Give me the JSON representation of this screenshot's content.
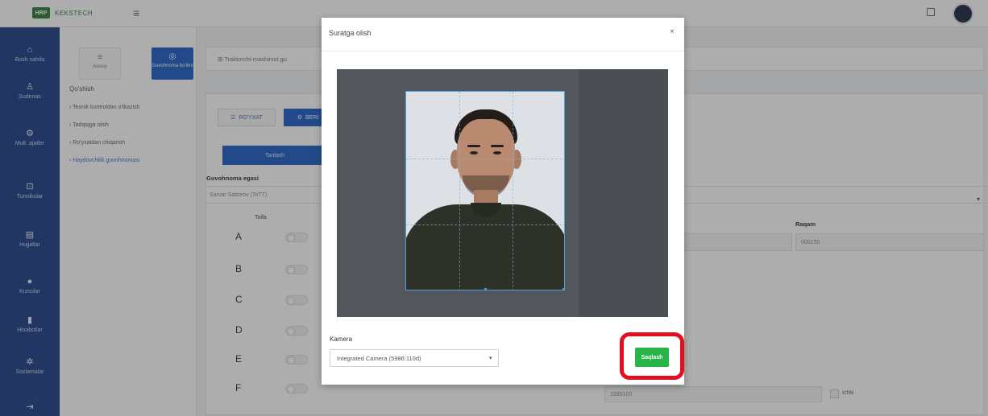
{
  "topbar": {
    "brand_badge": "HRP",
    "brand_name": "KEKSTECH",
    "menu_icon": "hamburger-icon"
  },
  "sidebar": {
    "items": [
      {
        "label": "Bosh sahifa",
        "icon": "home-icon"
      },
      {
        "label": "Sudenas",
        "icon": "user-icon"
      },
      {
        "label": "Mult. ajatler",
        "icon": "gear-icon"
      },
      {
        "label": "Tunnikular",
        "icon": "cart-icon"
      },
      {
        "label": "Hujjatlar",
        "icon": "doc-icon"
      },
      {
        "label": "Kursslar",
        "icon": "pin-icon"
      },
      {
        "label": "Hisobotlar",
        "icon": "file-icon"
      },
      {
        "label": "Sozlamalar",
        "icon": "cog-icon"
      },
      {
        "label": "",
        "icon": "logout-icon"
      }
    ]
  },
  "subpanel": {
    "tab_a": "Asosiy",
    "tab_b": "Guvohnoma bo'limi",
    "title": "Qo'shish",
    "nav": [
      "Texnik kontroldan o'tkazish",
      "Tadqiqga olish",
      "Ro'yxatdan chiqarish",
      "Haydovchilik guvohnomasi"
    ]
  },
  "content": {
    "breadcrumb": "Traktorchi-mashinist gu",
    "btn_list": "RO'YXAT",
    "btn_edit": "BERI",
    "btn_select": "Tanlash",
    "owner_label": "Guvohnoma egasi",
    "owner_value": "Sarvar Sattorov (ToTT)",
    "category_head": "Toifa",
    "categories": [
      "A",
      "B",
      "C",
      "D",
      "E",
      "F"
    ],
    "raqam_label": "Raqam",
    "raqam_value": "000150",
    "bottom_value": "1995100",
    "checkbox_label": "Ichki"
  },
  "modal": {
    "title": "Suratga olish",
    "close_glyph": "×",
    "camera_label": "Kamera",
    "camera_selected": "Integrated Camera (5986:110d)",
    "capture_button": "Saqlash",
    "highlight_color": "#e0101e",
    "capture_color": "#27b449"
  }
}
